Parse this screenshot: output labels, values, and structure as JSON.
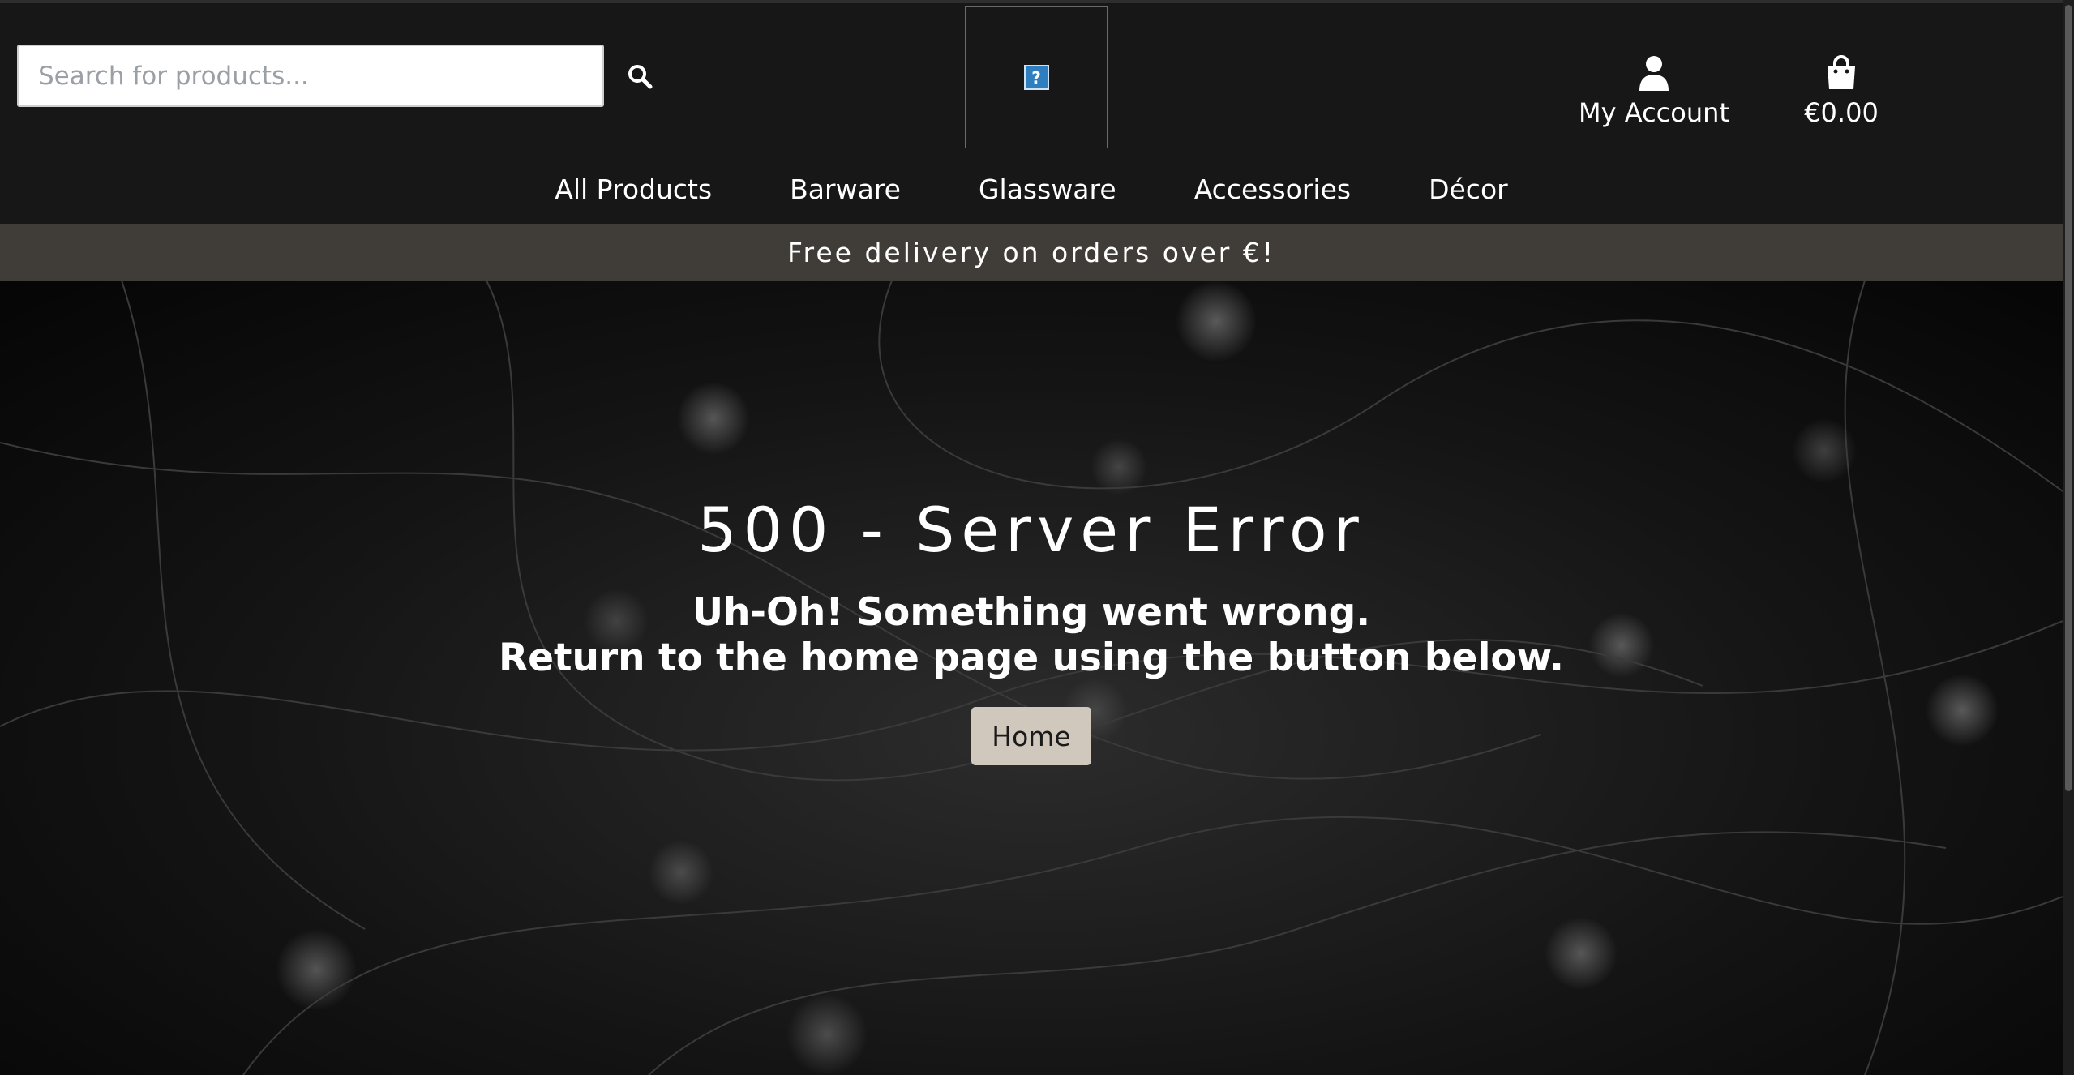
{
  "header": {
    "search": {
      "placeholder": "Search for products...",
      "icon": "search-icon"
    },
    "logo": {
      "icon": "broken-image-icon",
      "glyph": "?"
    },
    "account": {
      "label": "My Account",
      "icon": "user-icon"
    },
    "bag": {
      "total": "€0.00",
      "icon": "shopping-bag-icon"
    },
    "nav": [
      {
        "label": "All Products"
      },
      {
        "label": "Barware"
      },
      {
        "label": "Glassware"
      },
      {
        "label": "Accessories"
      },
      {
        "label": "Décor"
      }
    ]
  },
  "banner": {
    "text": "Free delivery on orders over €!"
  },
  "error": {
    "title": "500 - Server Error",
    "line1": "Uh-Oh! Something went wrong.",
    "line2": "Return to the home page using the button below.",
    "home_button": "Home"
  },
  "colors": {
    "header_bg": "#171717",
    "banner_bg": "#403d39",
    "button_bg": "#d1c8bd"
  }
}
